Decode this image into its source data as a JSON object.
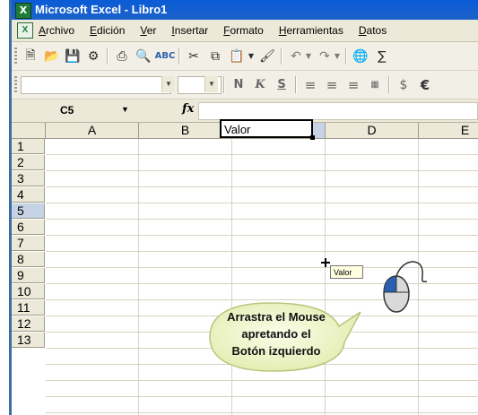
{
  "window": {
    "title": "Microsoft Excel - Libro1"
  },
  "menu": {
    "items": [
      "Archivo",
      "Edición",
      "Ver",
      "Insertar",
      "Formato",
      "Herramientas",
      "Datos"
    ]
  },
  "toolbar": {
    "icons": [
      "new-icon",
      "open-icon",
      "save-icon",
      "permissions-icon",
      "print-icon",
      "print-preview-icon",
      "spelling-icon",
      "cut-icon",
      "copy-icon",
      "paste-icon",
      "format-painter-icon",
      "undo-icon",
      "redo-icon",
      "hyperlink-icon"
    ]
  },
  "format_toolbar": {
    "font_name": "",
    "font_size": "",
    "bold": "N",
    "italic": "K",
    "underline": "S",
    "currency": "$",
    "euro": "€"
  },
  "formula_bar": {
    "name_box": "C5",
    "fx": "fx",
    "formula": ""
  },
  "sheet": {
    "columns": [
      "A",
      "B",
      "C",
      "D",
      "E"
    ],
    "selected_column": "C",
    "rows": [
      "1",
      "2",
      "3",
      "4",
      "5",
      "6",
      "7",
      "8",
      "9",
      "10",
      "11",
      "12",
      "13"
    ],
    "selected_row": "5",
    "active_cell": {
      "ref": "C5",
      "value": "Valor"
    }
  },
  "drag_tooltip": "Valor",
  "callout": {
    "line1": "Arrastra el Mouse",
    "line2": "apretando el",
    "line3": "Botón izquierdo"
  },
  "colors": {
    "titlebar": "#0a5bd6",
    "selected_header": "#c6d3e6",
    "callout_fill": "#eef5c8",
    "callout_stroke": "#b9c57a"
  }
}
